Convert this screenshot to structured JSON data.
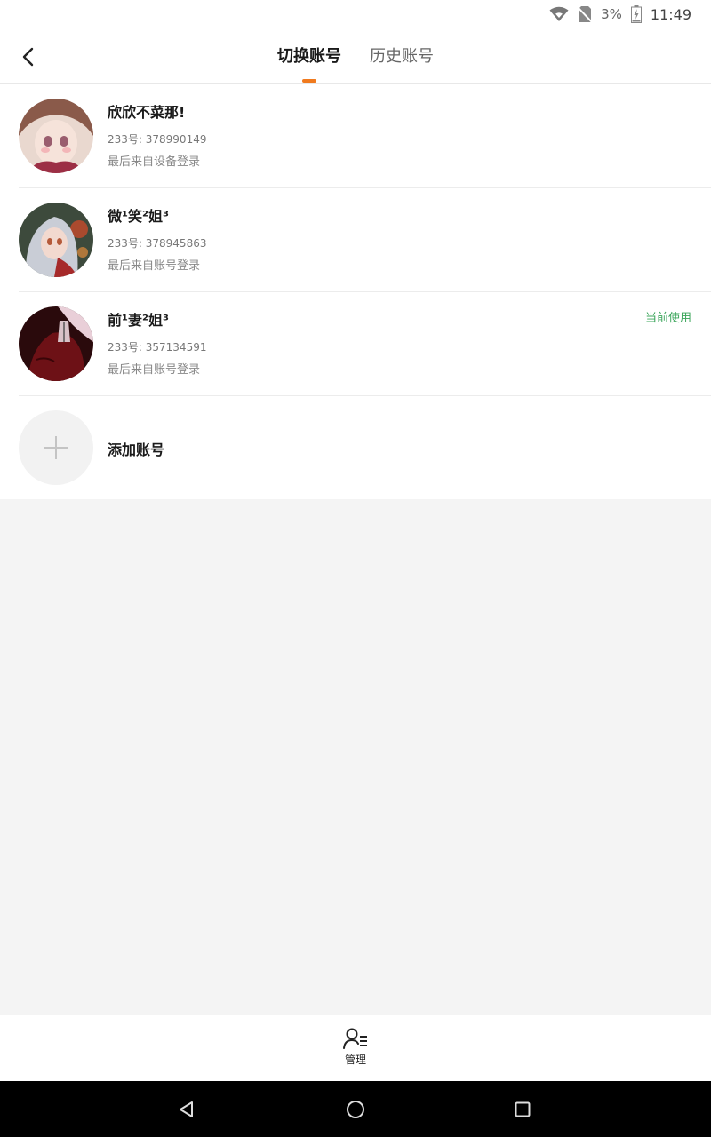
{
  "status_bar": {
    "battery_percent": "3%",
    "time": "11:49"
  },
  "header": {
    "tabs": [
      {
        "label": "切换账号",
        "active": true
      },
      {
        "label": "历史账号",
        "active": false
      }
    ],
    "accent_color": "#f07a1e"
  },
  "accounts": [
    {
      "name": "欣欣不菜那!",
      "uid": "233号: 378990149",
      "login_source": "最后来自设备登录",
      "current": false
    },
    {
      "name": "微¹笑²姐³",
      "uid": "233号: 378945863",
      "login_source": "最后来自账号登录",
      "current": false
    },
    {
      "name": "前¹妻²姐³",
      "uid": "233号: 357134591",
      "login_source": "最后来自账号登录",
      "current": true,
      "current_label": "当前使用"
    }
  ],
  "add_account": {
    "label": "添加账号"
  },
  "bottom_bar": {
    "manage_label": "管理"
  },
  "icons": [
    "back-arrow-icon",
    "wifi-icon",
    "no-sim-icon",
    "battery-charging-icon",
    "plus-icon",
    "user-list-icon",
    "nav-back-icon",
    "nav-home-icon",
    "nav-recent-icon"
  ]
}
